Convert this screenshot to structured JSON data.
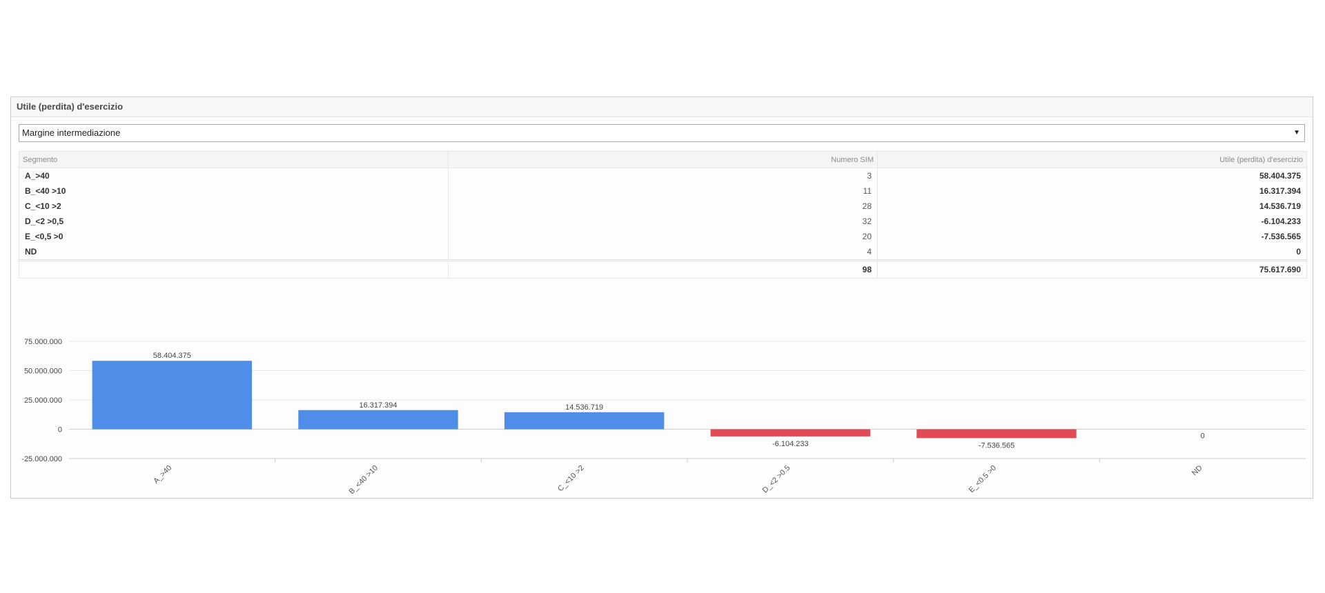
{
  "panel": {
    "title": "Utile (perdita) d'esercizio",
    "select_value": "Margine intermediazione"
  },
  "table": {
    "headers": [
      "Segmento",
      "Numero SIM",
      "Utile (perdita) d'esercizio"
    ],
    "rows": [
      {
        "segment": "A_>40",
        "count": "3",
        "value": "58.404.375"
      },
      {
        "segment": "B_<40 >10",
        "count": "11",
        "value": "16.317.394"
      },
      {
        "segment": "C_<10 >2",
        "count": "28",
        "value": "14.536.719"
      },
      {
        "segment": "D_<2 >0,5",
        "count": "32",
        "value": "-6.104.233"
      },
      {
        "segment": "E_<0,5 >0",
        "count": "20",
        "value": "-7.536.565"
      },
      {
        "segment": "ND",
        "count": "4",
        "value": "0"
      }
    ],
    "total": {
      "segment": "",
      "count": "98",
      "value": "75.617.690"
    }
  },
  "chart_data": {
    "type": "bar",
    "categories": [
      "A_>40",
      "B_<40 >10",
      "C_<10 >2",
      "D_<2 >0,5",
      "E_<0,5 >0",
      "ND"
    ],
    "category_tick_labels": [
      "A_>40",
      "B_<40 >10",
      "C_<10 >2",
      "D_<2 >0.5",
      "E_<0.5 >0",
      "ND"
    ],
    "values": [
      58404375,
      16317394,
      14536719,
      -6104233,
      -7536565,
      0
    ],
    "data_labels": [
      "58.404.375",
      "16.317.394",
      "14.536.719",
      "-6.104.233",
      "-7.536.565",
      "0"
    ],
    "ylim": [
      -25000000,
      75000000
    ],
    "yticks": [
      75000000,
      50000000,
      25000000,
      0,
      -25000000
    ],
    "ytick_labels": [
      "75.000.000",
      "50.000.000",
      "25.000.000",
      "0",
      "-25.000.000"
    ],
    "positive_color": "#4f8ee8",
    "negative_color": "#e24b55",
    "grid": true,
    "title": "",
    "xlabel": "",
    "ylabel": ""
  }
}
